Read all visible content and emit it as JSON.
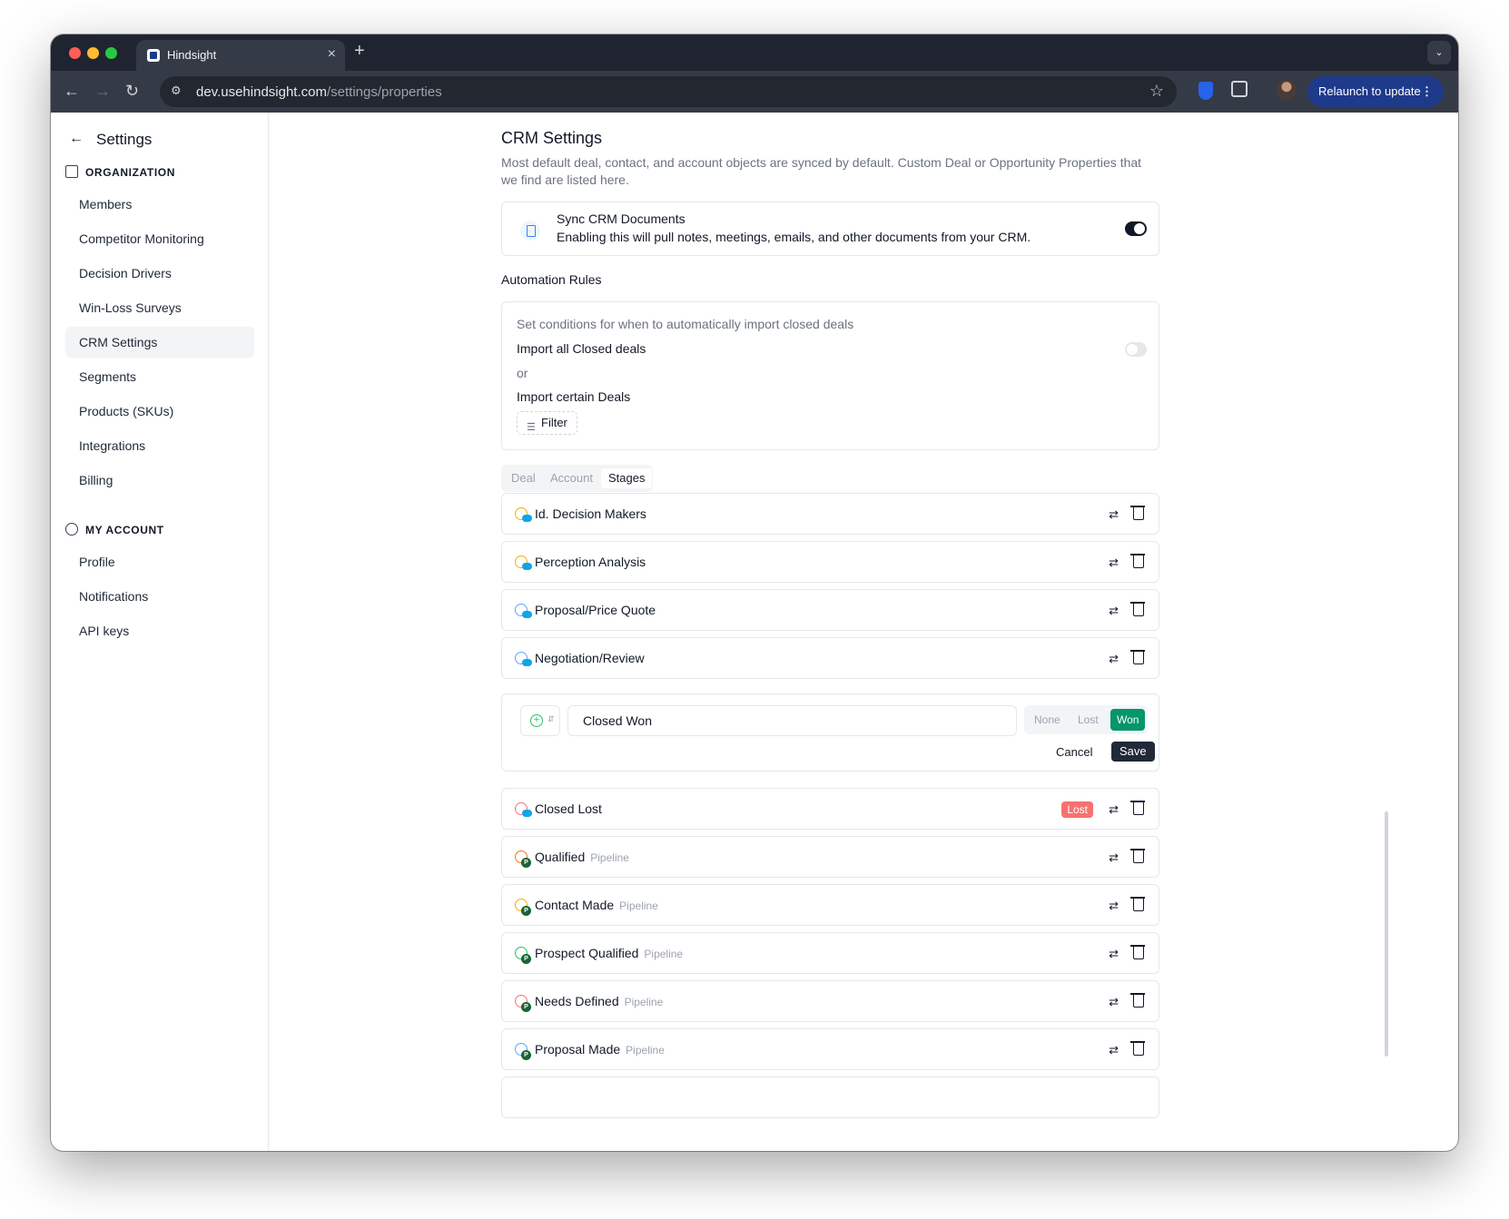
{
  "browser": {
    "tab_title": "Hindsight",
    "url_host": "dev.usehindsight.com",
    "url_path": "/settings/properties",
    "relaunch_label": "Relaunch to update"
  },
  "sidebar": {
    "title": "Settings",
    "org_section": "ORGANIZATION",
    "org_items": [
      {
        "label": "Members"
      },
      {
        "label": "Competitor Monitoring"
      },
      {
        "label": "Decision Drivers"
      },
      {
        "label": "Win-Loss Surveys"
      },
      {
        "label": "CRM Settings"
      },
      {
        "label": "Segments"
      },
      {
        "label": "Products (SKUs)"
      },
      {
        "label": "Integrations"
      },
      {
        "label": "Billing"
      }
    ],
    "account_section": "MY ACCOUNT",
    "account_items": [
      {
        "label": "Profile"
      },
      {
        "label": "Notifications"
      },
      {
        "label": "API keys"
      }
    ]
  },
  "main": {
    "title": "CRM Settings",
    "description": "Most default deal, contact, and account objects are synced by default. Custom Deal or Opportunity Properties that we find are listed here.",
    "sync": {
      "title": "Sync CRM Documents",
      "description": "Enabling this will pull notes, meetings, emails, and other documents from your CRM.",
      "enabled": true
    },
    "automation": {
      "title": "Automation Rules",
      "subtitle": "Set conditions for when to automatically import closed deals",
      "import_all_label": "Import all Closed deals",
      "import_all_enabled": false,
      "or_label": "or",
      "import_certain_label": "Import certain Deals",
      "filter_label": "Filter"
    },
    "tabs": [
      {
        "label": "Deal"
      },
      {
        "label": "Account"
      },
      {
        "label": "Stages"
      }
    ],
    "active_tab": "Stages",
    "stages_top": [
      {
        "name": "Id. Decision Makers",
        "icon": "yellow-circle-icon"
      },
      {
        "name": "Perception Analysis",
        "icon": "yellow-circle-icon"
      },
      {
        "name": "Proposal/Price Quote",
        "icon": "blue-circle-icon"
      },
      {
        "name": "Negotiation/Review",
        "icon": "blue-circle-icon"
      }
    ],
    "edit": {
      "value": "Closed Won",
      "options": [
        {
          "label": "None"
        },
        {
          "label": "Lost"
        },
        {
          "label": "Won"
        }
      ],
      "selected": "Won",
      "cancel_label": "Cancel",
      "save_label": "Save"
    },
    "stages_bottom": [
      {
        "name": "Closed Lost",
        "badge": "Lost",
        "tag": ""
      },
      {
        "name": "Qualified",
        "tag": "Pipeline"
      },
      {
        "name": "Contact Made",
        "tag": "Pipeline"
      },
      {
        "name": "Prospect Qualified",
        "tag": "Pipeline"
      },
      {
        "name": "Needs Defined",
        "tag": "Pipeline"
      },
      {
        "name": "Proposal Made",
        "tag": "Pipeline"
      }
    ],
    "pipeline_badge": "P"
  }
}
